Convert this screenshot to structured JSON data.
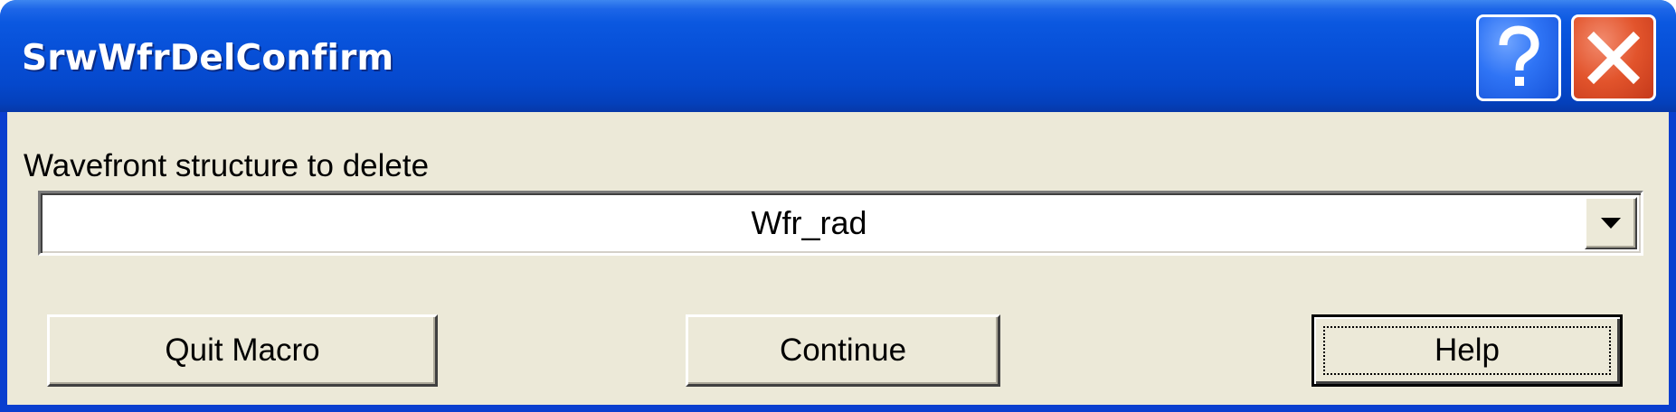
{
  "window": {
    "title": "SrwWfrDelConfirm",
    "help_button": "?",
    "close_button": "close"
  },
  "form": {
    "label": "Wavefront structure to delete",
    "selected_value": "Wfr_rad"
  },
  "buttons": {
    "quit": "Quit Macro",
    "continue": "Continue",
    "help": "Help"
  },
  "colors": {
    "titlebar": "#0a4fd8",
    "client_background": "#ece9d8",
    "close_button": "#e2542c",
    "help_button": "#2f74f5"
  },
  "icons": {
    "help": "question-mark-icon",
    "close": "close-x-icon",
    "dropdown": "chevron-down-icon"
  }
}
